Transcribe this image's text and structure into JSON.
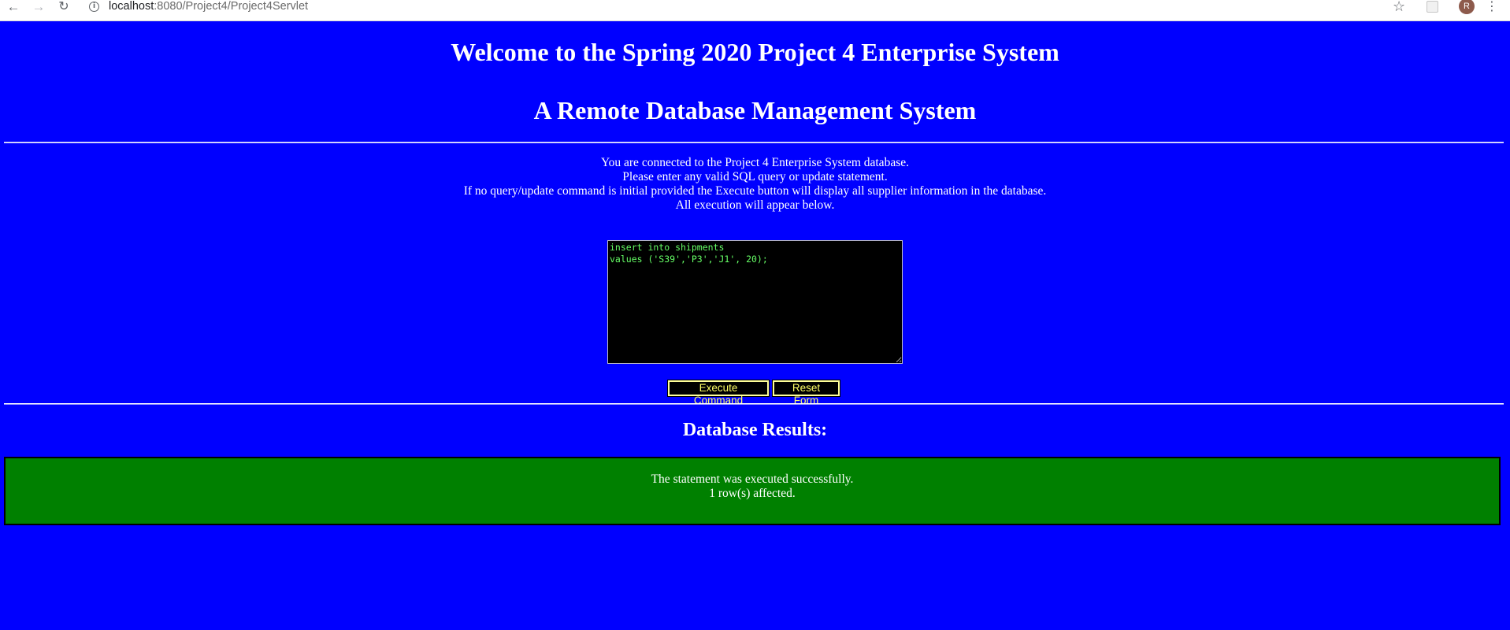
{
  "browser": {
    "url_host": "localhost",
    "url_rest": ":8080/Project4/Project4Servlet",
    "avatar_initial": "R"
  },
  "page": {
    "title": "Welcome to the Spring 2020 Project 4 Enterprise System",
    "subtitle": "A Remote Database Management System",
    "intro_lines": [
      "You are connected to the Project 4 Enterprise System database.",
      "Please enter any valid SQL query or update statement.",
      "If no query/update command is initial provided the Execute button will display all supplier information in the database.",
      "All execution will appear below."
    ],
    "sql_input": "insert into shipments\nvalues ('S39','P3','J1', 20);",
    "execute_label": "Execute Command",
    "reset_label": "Reset Form",
    "results_title": "Database Results:",
    "result_lines": [
      "The statement was executed successfully.",
      "1 row(s) affected."
    ]
  },
  "colors": {
    "background": "#0000ff",
    "result_panel": "#008000",
    "sql_text": "#66ff66",
    "button_text": "#ffff66"
  },
  "icons": [
    "back-arrow-icon",
    "forward-arrow-icon",
    "reload-icon",
    "info-icon",
    "star-icon",
    "extension-icon",
    "menu-icon"
  ]
}
